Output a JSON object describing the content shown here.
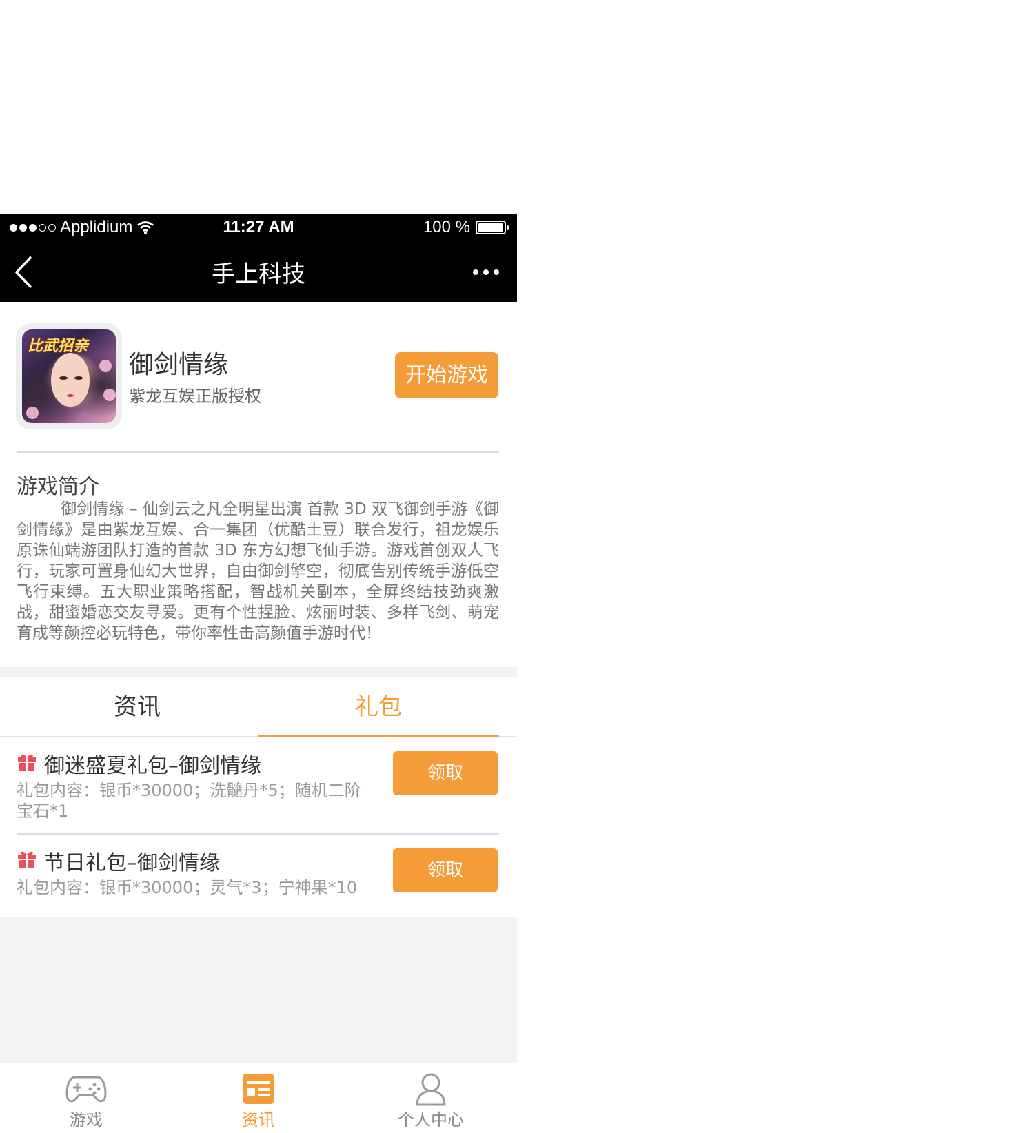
{
  "status_bar": {
    "carrier": "Applidium",
    "time": "11:27 AM",
    "battery": "100 %"
  },
  "nav": {
    "title": "手上科技",
    "back_icon": "chevron-left-icon",
    "more_icon": "ellipsis-icon"
  },
  "game": {
    "name": "御剑情缘",
    "subtitle": "紫龙互娱正版授权",
    "logo_text": "比武招亲",
    "start_label": "开始游戏"
  },
  "intro": {
    "title": "游戏简介",
    "text": "御剑情缘 – 仙剑云之凡全明星出演 首款 3D 双飞御剑手游《御剑情缘》是由紫龙互娱、合一集团（优酷土豆）联合发行，祖龙娱乐原诛仙端游团队打造的首款 3D 东方幻想飞仙手游。游戏首创双人飞行，玩家可置身仙幻大世界，自由御剑擎空，彻底告别传统手游低空飞行束缚。五大职业策略搭配，智战机关副本，全屏终结技劲爽激战，甜蜜婚恋交友寻爱。更有个性捏脸、炫丽时装、多样飞剑、萌宠育成等颜控必玩特色，带你率性击高颜值手游时代！"
  },
  "tabs": [
    {
      "label": "资讯",
      "active": false
    },
    {
      "label": "礼包",
      "active": true
    }
  ],
  "gifts": [
    {
      "name": "御迷盛夏礼包–御剑情缘",
      "content": "礼包内容：银币*30000；洗髓丹*5；随机二阶宝石*1",
      "claim_label": "领取",
      "icon": "gift-icon"
    },
    {
      "name": "节日礼包–御剑情缘",
      "content": "礼包内容：银币*30000；灵气*3；宁神果*10",
      "claim_label": "领取",
      "icon": "gift-icon"
    }
  ],
  "tabbar": [
    {
      "label": "游戏",
      "icon": "gamepad-icon",
      "active": false
    },
    {
      "label": "资讯",
      "icon": "news-icon",
      "active": true
    },
    {
      "label": "个人中心",
      "icon": "user-icon",
      "active": false
    }
  ],
  "colors": {
    "accent": "#f39c38",
    "gift_red": "#e8505b",
    "nav_bg": "#000000"
  }
}
